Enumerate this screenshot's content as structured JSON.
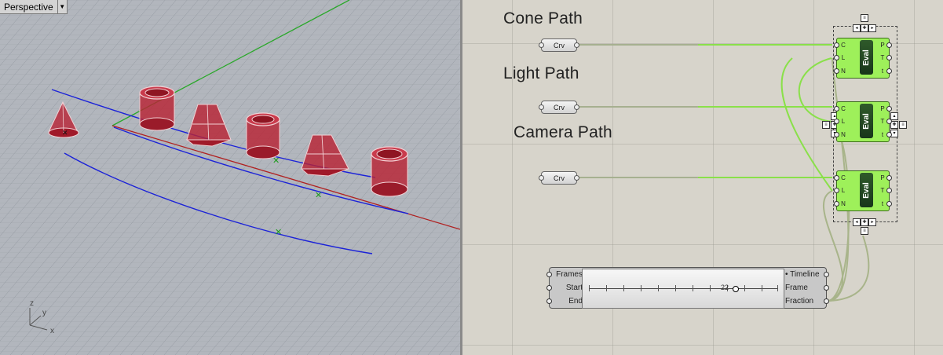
{
  "viewport": {
    "name": "Perspective",
    "axes": {
      "x": "x",
      "y": "y",
      "z": "z"
    }
  },
  "canvas": {
    "groups": [
      {
        "label": "Cone Path"
      },
      {
        "label": "Light Path"
      },
      {
        "label": "Camera Path"
      }
    ],
    "crv_params": [
      "Crv",
      "Crv",
      "Crv"
    ],
    "eval_component": {
      "name": "Eval",
      "inputs": [
        "C",
        "L",
        "N"
      ],
      "outputs": [
        "P",
        "T",
        "t"
      ]
    },
    "timeline": {
      "inputs": [
        "Frames",
        "Start",
        "End"
      ],
      "outputs": [
        "• Timeline",
        "Frame",
        "Fraction"
      ],
      "value": "22"
    },
    "colors": {
      "component": "#9ef05a",
      "wire": "#8ae04a",
      "viewport_curve": "#1b22d8",
      "viewport_axis_x": "#b02020",
      "viewport_axis_y": "#2aa82a"
    }
  }
}
